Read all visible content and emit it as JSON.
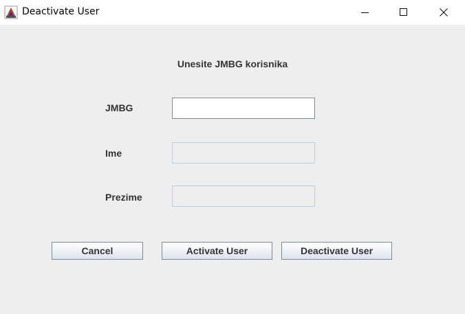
{
  "window": {
    "title": "Deactivate User",
    "app_icon": "java-cup-icon",
    "controls": [
      "minimize-icon",
      "maximize-icon",
      "close-icon"
    ]
  },
  "form": {
    "heading": "Unesite JMBG korisnika",
    "fields": [
      {
        "label": "JMBG",
        "value": "",
        "enabled": true
      },
      {
        "label": "Ime",
        "value": "",
        "enabled": false
      },
      {
        "label": "Prezime",
        "value": "",
        "enabled": false
      }
    ]
  },
  "buttons": {
    "cancel": "Cancel",
    "activate": "Activate User",
    "deactivate": "Deactivate User"
  },
  "colors": {
    "panel_background": "#eeeeee",
    "disabled_border": "#b8cfe5",
    "text": "#333333"
  }
}
